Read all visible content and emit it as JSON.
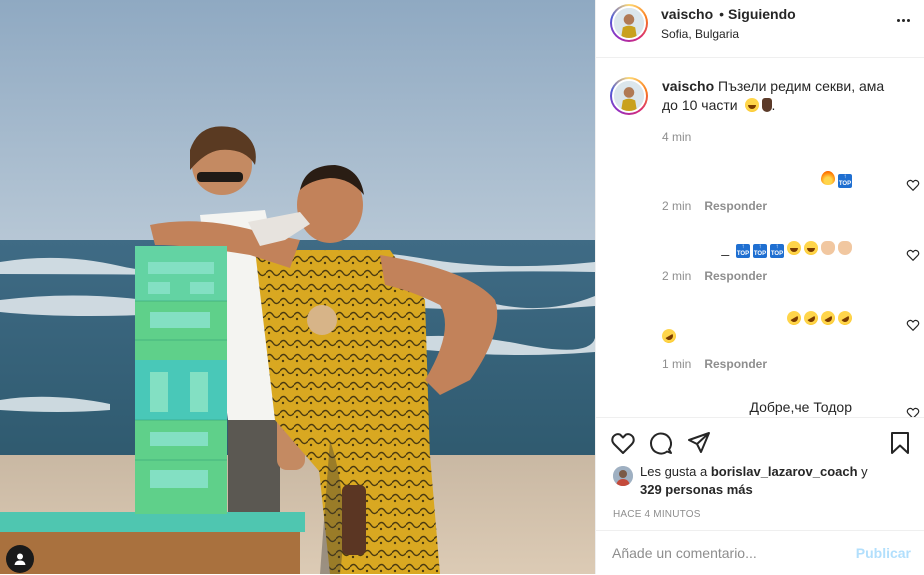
{
  "post": {
    "username": "vaischo",
    "follow_status": "Siguiendo",
    "separator": "•",
    "location": "Sofia, Bulgaria"
  },
  "caption": {
    "username": "vaischo",
    "text": "Пъзели редим секви, ама до 10 части",
    "time": "4 min"
  },
  "comments": [
    {
      "body_tail": "",
      "time": "2 min",
      "reply_label": "Responder",
      "emojis": [
        "fire",
        "top"
      ]
    },
    {
      "body_tail": "_",
      "time": "2 min",
      "reply_label": "Responder",
      "emojis": [
        "top",
        "top",
        "top",
        "laugh",
        "laugh",
        "clap",
        "clap"
      ]
    },
    {
      "body_tail": "",
      "time": "1 min",
      "reply_label": "Responder",
      "emojis": [
        "rofl",
        "rofl",
        "rofl",
        "rofl",
        "rofl"
      ]
    },
    {
      "body_tail": "Добре,че Тодор",
      "time": "",
      "reply_label": "",
      "emojis": []
    }
  ],
  "likes": {
    "prefix": "Les gusta a",
    "user": "borislav_lazarov_coach",
    "joiner": "y",
    "others": "329 personas más"
  },
  "posted_ago": "HACE 4 MINUTOS",
  "comment_box": {
    "placeholder": "Añade un comentario...",
    "publish_label": "Publicar"
  },
  "colors": {
    "publish_disabled": "#b2dffc",
    "muted_text": "#8e8e8e",
    "divider": "#efefef"
  },
  "icons": [
    "more-options-icon",
    "heart-icon",
    "comment-icon",
    "share-icon",
    "bookmark-icon",
    "user-tag-icon"
  ]
}
